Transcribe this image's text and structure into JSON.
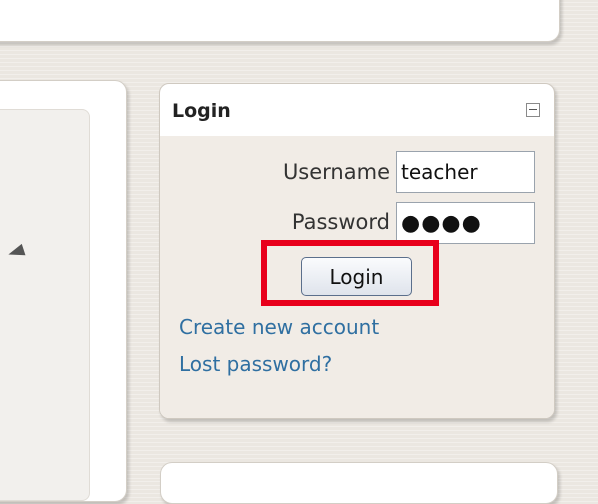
{
  "login_block": {
    "title": "Login",
    "username": {
      "label": "Username",
      "value": "teacher"
    },
    "password": {
      "label": "Password",
      "value": "●●●●"
    },
    "login_button": "Login",
    "links": {
      "create_account": "Create new account",
      "lost_password": "Lost password?"
    }
  },
  "icons": {
    "collapse": "collapse-minus-icon"
  },
  "colors": {
    "link": "#2f6fa1",
    "highlight": "#e8001c",
    "block_body": "#f1ece6"
  }
}
